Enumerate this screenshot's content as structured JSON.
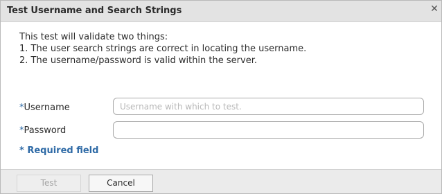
{
  "dialog": {
    "title": "Test Username and Search Strings",
    "close_glyph": "✕",
    "close_icon": "close-icon"
  },
  "intro": {
    "line1": "This test will validate two things:",
    "line2": "1. The user search strings are correct in locating the username.",
    "line3": "2. The username/password is valid within the server."
  },
  "form": {
    "username": {
      "required_mark": "*",
      "label": "Username",
      "value": "",
      "placeholder": "Username with which to test."
    },
    "password": {
      "required_mark": "*",
      "label": "Password",
      "value": "",
      "placeholder": ""
    },
    "required_note": "* Required field"
  },
  "footer": {
    "test_label": "Test",
    "test_disabled": true,
    "cancel_label": "Cancel"
  },
  "colors": {
    "accent": "#2e6aa6",
    "titlebar": "#e3e3e3",
    "footer": "#ebebeb"
  }
}
